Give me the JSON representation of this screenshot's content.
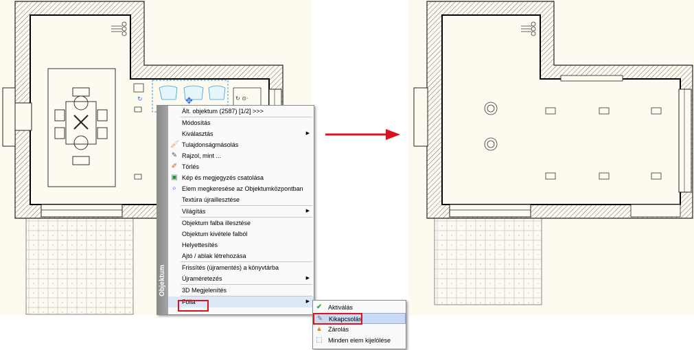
{
  "context_menu": {
    "strip_label": "Objektum",
    "items": [
      {
        "label": "Ált. objektum (2587) [1/2] >>>",
        "icon": "none",
        "submenu": false
      },
      {
        "label": "Módosítás",
        "icon": "none",
        "submenu": false
      },
      {
        "label": "Kiválasztás",
        "icon": "none",
        "submenu": true
      },
      {
        "label": "Tulajdonságmásolás",
        "icon": "brush-icon",
        "submenu": false
      },
      {
        "label": "Rajzol, mint ...",
        "icon": "pipette-icon",
        "submenu": false
      },
      {
        "label": "Törlés",
        "icon": "eraser-icon",
        "submenu": false
      },
      {
        "label": "Kép és megjegyzés csatolása",
        "icon": "image-icon",
        "submenu": false
      },
      {
        "label": "Elem megkeresése az Objektumközpontban",
        "icon": "search-icon",
        "submenu": false
      },
      {
        "label": "Textúra újraillesztése",
        "icon": "none",
        "submenu": false
      },
      {
        "label": "Világítás",
        "icon": "none",
        "submenu": true
      },
      {
        "label": "Objektum falba illesztése",
        "icon": "none",
        "submenu": false
      },
      {
        "label": "Objektum kivétele falból",
        "icon": "none",
        "submenu": false
      },
      {
        "label": "Helyettesítés",
        "icon": "none",
        "submenu": false
      },
      {
        "label": "Ajtó / ablak létrehozása",
        "icon": "none",
        "submenu": false
      },
      {
        "label": "Frissítés (újramentés) a könyvtárba",
        "icon": "none",
        "submenu": false
      },
      {
        "label": "Újraméretezés",
        "icon": "none",
        "submenu": true
      },
      {
        "label": "3D Megjelenítés",
        "icon": "none",
        "submenu": false
      },
      {
        "label": "Fólia",
        "icon": "none",
        "submenu": true
      }
    ]
  },
  "submenu": {
    "items": [
      {
        "label": "Aktiválás",
        "icon": "check-icon"
      },
      {
        "label": "Kikapcsolás",
        "icon": "pencil-icon"
      },
      {
        "label": "Zárolás",
        "icon": "lock-icon"
      },
      {
        "label": "Minden elem kijelölése",
        "icon": "select-all-icon"
      }
    ]
  },
  "colors": {
    "highlight_box": "#d9141e",
    "arrow": "#d9141e",
    "canvas_bg": "#fdfaf0",
    "selection": "#2f9fd8"
  }
}
